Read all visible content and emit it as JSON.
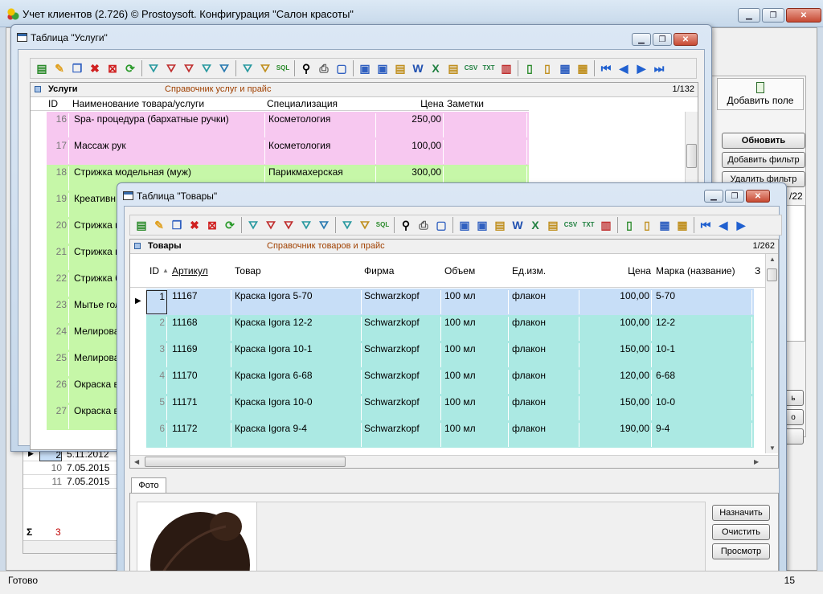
{
  "app": {
    "title": "Учет клиентов (2.726) © Prostoysoft. Конфигурация \"Салон красоты\"",
    "status": "Готово",
    "status_right": "15"
  },
  "right_panel": {
    "add_field": "Добавить поле",
    "refresh": "Обновить",
    "add_filter": "Добавить фильтр",
    "remove_filter": "Удалить фильтр",
    "counter": "/22"
  },
  "bottom_grid": {
    "rows": [
      {
        "id": "2",
        "date": "5.11.2012"
      },
      {
        "id": "10",
        "date": "7.05.2015"
      },
      {
        "id": "11",
        "date": "7.05.2015"
      }
    ],
    "sigma": "Σ",
    "sum": "3"
  },
  "services": {
    "window_title": "Таблица \"Услуги\"",
    "caption": "Услуги",
    "subcaption": "Справочник услуг и прайс",
    "counter": "1/132",
    "columns": [
      "ID",
      "Наименование товара/услуги",
      "Специализация",
      "Цена",
      "Заметки"
    ],
    "rows": [
      {
        "id": "16",
        "name": "Spa- процедура (бархатные ручки)",
        "spec": "Косметология",
        "price": "250,00"
      },
      {
        "id": "17",
        "name": "Массаж рук",
        "spec": "Косметология",
        "price": "100,00"
      },
      {
        "id": "18",
        "name": "Стрижка модельная (муж)",
        "spec": "Парикмахерская",
        "price": "300,00"
      },
      {
        "id": "19",
        "name": "Креативн",
        "spec": "",
        "price": ""
      },
      {
        "id": "20",
        "name": "Стрижка п",
        "spec": "",
        "price": ""
      },
      {
        "id": "21",
        "name": "Стрижка н",
        "spec": "",
        "price": ""
      },
      {
        "id": "22",
        "name": "Стрижка б",
        "spec": "",
        "price": ""
      },
      {
        "id": "23",
        "name": "Мытье гол",
        "spec": "",
        "price": ""
      },
      {
        "id": "24",
        "name": "Мелирова",
        "spec": "",
        "price": ""
      },
      {
        "id": "25",
        "name": "Мелирова",
        "spec": "",
        "price": ""
      },
      {
        "id": "26",
        "name": "Окраска в",
        "spec": "",
        "price": ""
      },
      {
        "id": "27",
        "name": "Окраска в",
        "spec": "",
        "price": ""
      }
    ]
  },
  "goods": {
    "window_title": "Таблица \"Товары\"",
    "caption": "Товары",
    "subcaption": "Справочник товаров и прайс",
    "counter": "1/262",
    "columns": [
      "ID",
      "Артикул",
      "Товар",
      "Фирма",
      "Объем",
      "Ед.изм.",
      "Цена",
      "Марка (название)",
      "З"
    ],
    "rows": [
      {
        "id": "1",
        "art": "11167",
        "name": "Краска Igora 5-70",
        "firm": "Schwarzkopf",
        "vol": "100 мл",
        "unit": "флакон",
        "price": "100,00",
        "brand": "5-70"
      },
      {
        "id": "2",
        "art": "11168",
        "name": "Краска Igora 12-2",
        "firm": "Schwarzkopf",
        "vol": "100 мл",
        "unit": "флакон",
        "price": "100,00",
        "brand": "12-2"
      },
      {
        "id": "3",
        "art": "11169",
        "name": "Краска Igora 10-1",
        "firm": "Schwarzkopf",
        "vol": "100 мл",
        "unit": "флакон",
        "price": "150,00",
        "brand": "10-1"
      },
      {
        "id": "4",
        "art": "11170",
        "name": "Краска Igora 6-68",
        "firm": "Schwarzkopf",
        "vol": "100 мл",
        "unit": "флакон",
        "price": "120,00",
        "brand": "6-68"
      },
      {
        "id": "5",
        "art": "11171",
        "name": "Краска Igora 10-0",
        "firm": "Schwarzkopf",
        "vol": "100 мл",
        "unit": "флакон",
        "price": "150,00",
        "brand": "10-0"
      },
      {
        "id": "6",
        "art": "11172",
        "name": "Краска Igora 9-4",
        "firm": "Schwarzkopf",
        "vol": "100 мл",
        "unit": "флакон",
        "price": "190,00",
        "brand": "9-4"
      }
    ],
    "photo_tab": "Фото",
    "assign": "Назначить",
    "clear": "Очистить",
    "view": "Просмотр"
  },
  "colors": {
    "pink": "#f7c8f0",
    "green": "#c6f7a8",
    "teal": "#abe9e3",
    "selected": "#c7def7"
  }
}
